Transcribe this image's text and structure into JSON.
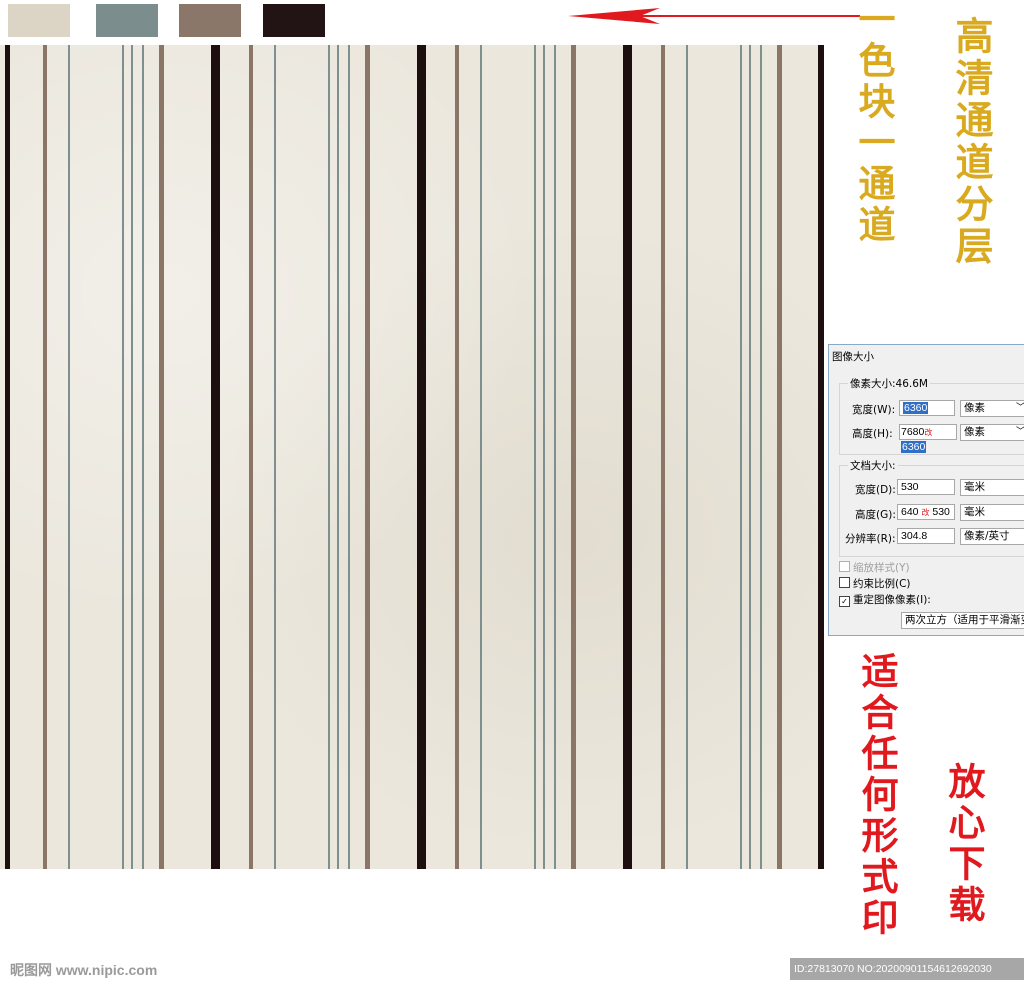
{
  "swatches": [
    {
      "name": "beige",
      "color": "#dcd5c6"
    },
    {
      "name": "grey-blue",
      "color": "#7c8d8e"
    },
    {
      "name": "taupe",
      "color": "#8b776a"
    },
    {
      "name": "dark-brown",
      "color": "#221314"
    }
  ],
  "captions": {
    "channel": "一色块一通道",
    "layers": "高清通道分层",
    "print": "适合任何形式印",
    "download": "放心下载"
  },
  "dialog": {
    "title": "图像大小",
    "pixel_size": "像素大小:46.6M",
    "width_label": "宽度(W):",
    "width_value": "6360",
    "height_label": "高度(H):",
    "height_old": "7680",
    "height_mark": "改",
    "height_value": "6360",
    "pixel_unit": "像素",
    "doc_size": "文档大小:",
    "doc_width_label": "宽度(D):",
    "doc_width_value": "530",
    "doc_height_label": "高度(G):",
    "doc_height_old": "640",
    "doc_height_mark": "改",
    "doc_height_value": "530",
    "mm_unit": "毫米",
    "res_label": "分辨率(R):",
    "res_value": "304.8",
    "res_unit": "像素/英寸",
    "scale_styles": "缩放样式(Y)",
    "constrain": "约束比例(C)",
    "resample": "重定图像像素(I):",
    "resample_method": "两次立方（适用于平滑渐变"
  },
  "watermark": {
    "logo": "昵图网 www.nipic.com",
    "id": "ID:27813070 NO:20200901154612692030"
  },
  "colors": {
    "dark": "#1d0f10",
    "taupe": "#8a7566",
    "grey": "#7f8f90",
    "arrow": "#e0191e"
  }
}
